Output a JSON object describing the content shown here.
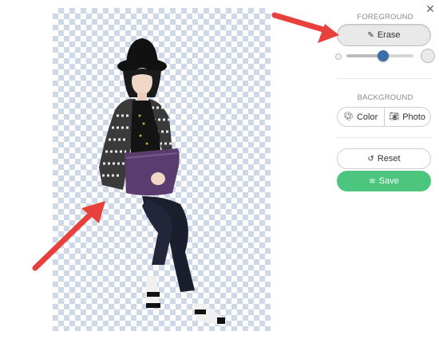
{
  "panel": {
    "close_symbol": "✕",
    "foreground": {
      "title": "FOREGROUND",
      "erase_label": "Erase",
      "erase_icon": "pencil-icon",
      "brush_size_fraction": 0.55
    },
    "background": {
      "title": "BACKGROUND",
      "color_label": "Color",
      "color_icon": "palette-icon",
      "photo_label": "Photo",
      "photo_icon": "camera-icon"
    },
    "reset_label": "Reset",
    "reset_icon": "undo-icon",
    "save_label": "Save",
    "save_icon": "stack-icon"
  },
  "colors": {
    "save_green": "#4cc57f",
    "slider_thumb": "#3b6ea8",
    "arrow_red": "#e8403c",
    "checker": "#cfd8e6"
  }
}
